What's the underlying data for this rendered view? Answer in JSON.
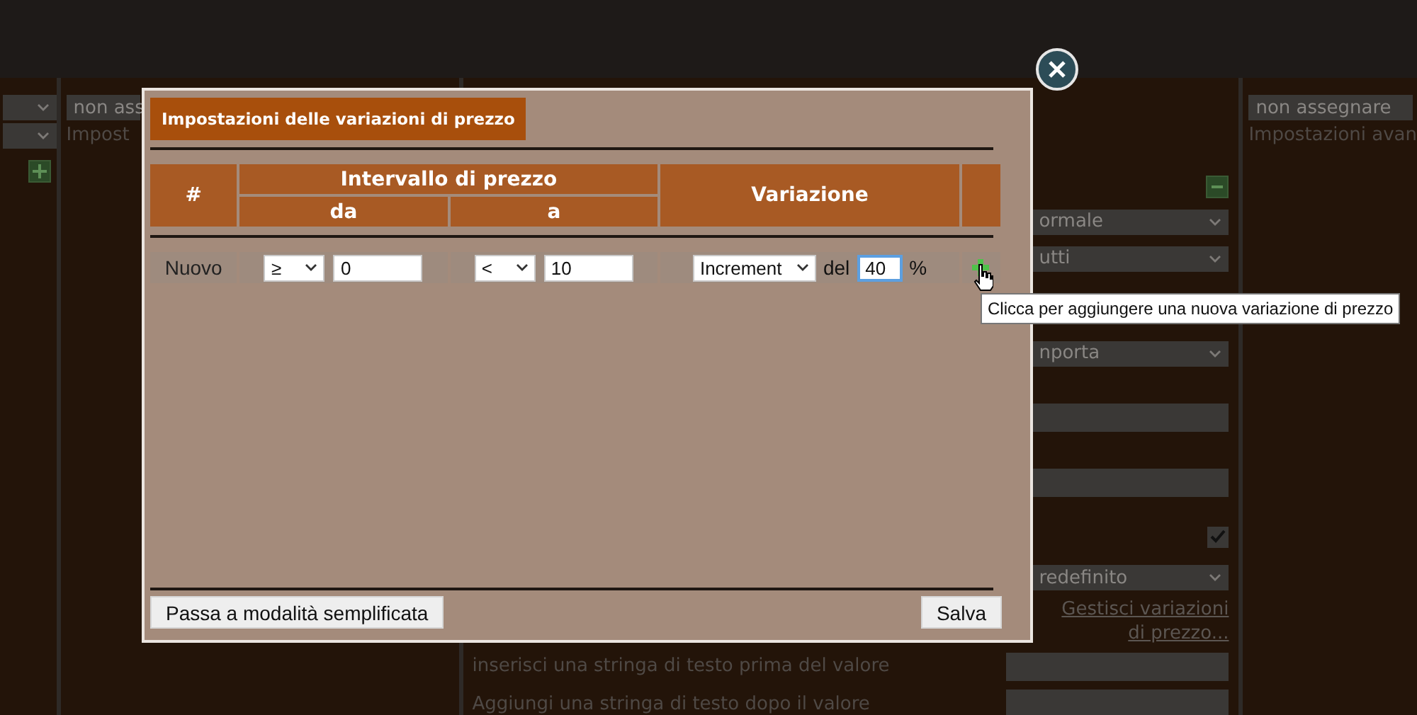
{
  "left_panel": {
    "select_value": "non ass",
    "text": "Impost"
  },
  "middle_panel": {
    "items": [
      {
        "kind": "toggle"
      },
      {
        "kind": "select",
        "value": "ormale"
      },
      {
        "kind": "select",
        "value": "utti"
      },
      {
        "kind": "gap"
      },
      {
        "kind": "select",
        "value": "nporta"
      },
      {
        "kind": "input"
      },
      {
        "kind": "input"
      },
      {
        "kind": "checkbox",
        "checked": true
      },
      {
        "kind": "select",
        "value": "redefinito"
      },
      {
        "kind": "link",
        "text": "Gestisci variazioni di prezzo..."
      },
      {
        "kind": "labeled-input",
        "label": "inserisci una stringa di testo prima del valore"
      },
      {
        "kind": "labeled-input",
        "label": "Aggiungi una stringa di testo dopo il valore"
      }
    ]
  },
  "right_panel": {
    "select_value": "non assegnare",
    "text": "Impostazioni avan"
  },
  "dialog": {
    "title": "Impostazioni delle variazioni di prezzo",
    "table": {
      "columns": {
        "number": "#",
        "range": "Intervallo di prezzo",
        "from": "da",
        "to": "a",
        "variation": "Variazione"
      },
      "row": {
        "label": "Nuovo",
        "from_operator": "≥",
        "from_value": "0",
        "to_operator": "<",
        "to_value": "10",
        "variation_type": "Increment",
        "del_label": "del",
        "percent_value": "40",
        "percent_sign": "%"
      }
    },
    "buttons": {
      "simplified": "Passa a modalità semplificata",
      "save": "Salva"
    },
    "tooltip": "Clicca per aggiungere una nuova variazione di prezzo"
  }
}
